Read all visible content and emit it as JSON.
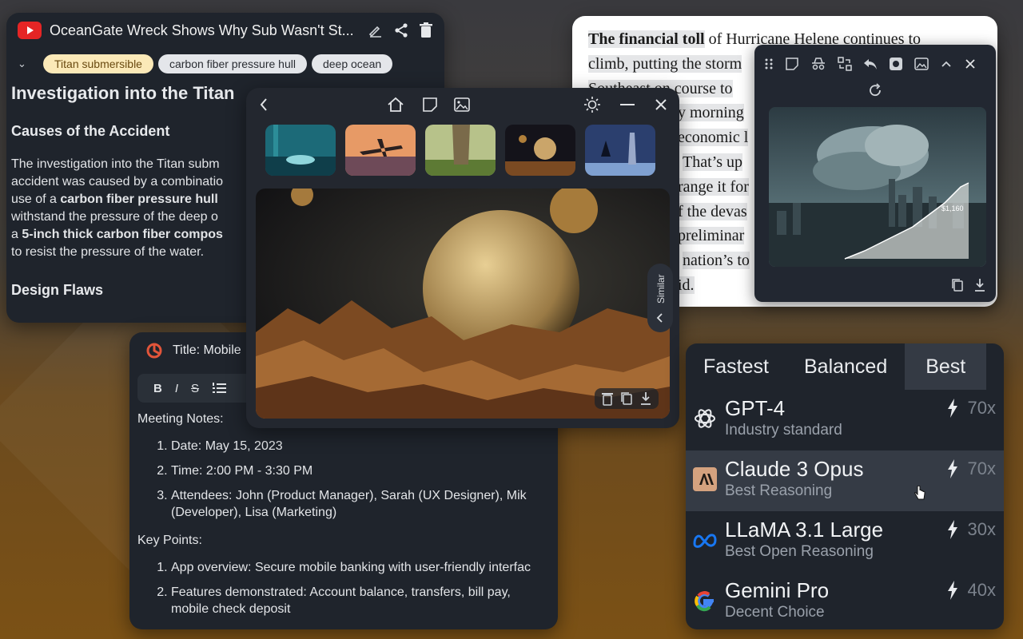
{
  "article": {
    "title": "OceanGate Wreck Shows Why Sub Wasn't St...",
    "tags": [
      "Titan submersible",
      "carbon fiber pressure hull",
      "deep ocean"
    ],
    "heading": "Investigation into the Titan",
    "section1": "Causes of the Accident",
    "para_lines": [
      "The investigation into the Titan subm",
      "accident was caused by a combinatio",
      "use of a ",
      "withstand the pressure of the deep o",
      "a ",
      "to resist the pressure of the water."
    ],
    "bold_hull": "carbon fiber pressure hull",
    "bold_composite": "5-inch thick carbon fiber compos",
    "section2": "Design Flaws"
  },
  "meeting": {
    "title": "Title: Mobile",
    "toolbar": [
      "B",
      "I",
      "S",
      "list"
    ],
    "notes_label": "Meeting Notes:",
    "notes": [
      "Date: May 15, 2023",
      "Time: 2:00 PM - 3:30 PM",
      "Attendees: John (Product Manager), Sarah (UX Designer), Mik",
      "(Developer), Lisa (Marketing)"
    ],
    "key_label": "Key Points:",
    "key_points": [
      "App overview: Secure mobile banking with user-friendly interfac",
      "Features demonstrated: Account balance, transfers, bill pay,",
      "mobile check deposit"
    ]
  },
  "viewer": {
    "similar_label": "Similar",
    "thumbnails": [
      "underwater-thumb",
      "plane-thumb",
      "tree-thumb",
      "planets-thumb",
      "wizard-thumb"
    ]
  },
  "doc": {
    "lines": [
      {
        "bold": "The financial toll",
        "rest": " of Hurricane Helene continues to"
      },
      {
        "bold": "",
        "rest": "climb, putting the storm"
      },
      {
        "bold": "",
        "rest": "Southeast on course to"
      },
      {
        "bold": "",
        "rest": "y morning"
      },
      {
        "bold": "",
        "rest": "economic l"
      },
      {
        "bold": "",
        "rest": "That’s up"
      },
      {
        "bold": "",
        "rest": "range it for"
      },
      {
        "bold": "",
        "rest": "f the devas"
      },
      {
        "bold": "",
        "rest": "preliminar"
      },
      {
        "bold": "",
        "rest": "nation’s to"
      },
      {
        "bold": "",
        "rest": "id."
      }
    ]
  },
  "popup": {
    "chart_label": "$1,160"
  },
  "models": {
    "tabs": [
      "Fastest",
      "Balanced",
      "Best"
    ],
    "selected_tab": "Best",
    "items": [
      {
        "name": "GPT-4",
        "sub": "Industry standard",
        "speed": "70x",
        "logo": "openai-icon"
      },
      {
        "name": "Claude 3 Opus",
        "sub": "Best Reasoning",
        "speed": "70x",
        "logo": "anthropic-icon"
      },
      {
        "name": "LLaMA 3.1 Large",
        "sub": "Best Open Reasoning",
        "speed": "30x",
        "logo": "meta-icon"
      },
      {
        "name": "Gemini Pro",
        "sub": "Decent Choice",
        "speed": "40x",
        "logo": "google-icon"
      }
    ]
  },
  "colors": {
    "accent_tag": "#fbe9b8",
    "panel_bg": "#1f242c",
    "youtube_red": "#e52525"
  }
}
